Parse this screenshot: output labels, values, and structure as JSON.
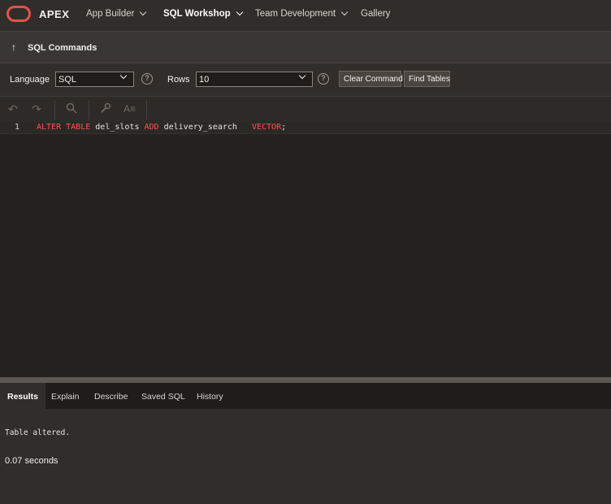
{
  "brand": "APEX",
  "nav": {
    "app_builder": "App Builder",
    "sql_workshop": "SQL Workshop",
    "team_development": "Team Development",
    "gallery": "Gallery"
  },
  "breadcrumb": {
    "title": "SQL Commands"
  },
  "controls": {
    "language_label": "Language",
    "language_value": "SQL",
    "rows_label": "Rows",
    "rows_value": "10",
    "help_glyph": "?",
    "clear_command": "Clear Command",
    "find_tables": "Find Tables"
  },
  "editor": {
    "line_number": "1",
    "code": {
      "alter": "ALTER",
      "table": "TABLE",
      "name": "del_slots",
      "add": "ADD",
      "column": "delivery_search",
      "type": "VECTOR",
      "semicolon": ";"
    }
  },
  "tabs": [
    "Results",
    "Explain",
    "Describe",
    "Saved SQL",
    "History"
  ],
  "results": {
    "message": "Table altered.",
    "time": "0.07 seconds"
  },
  "colors": {
    "keyword": "#ff5050",
    "logo": "#e0544b",
    "background": "#312d2a"
  }
}
